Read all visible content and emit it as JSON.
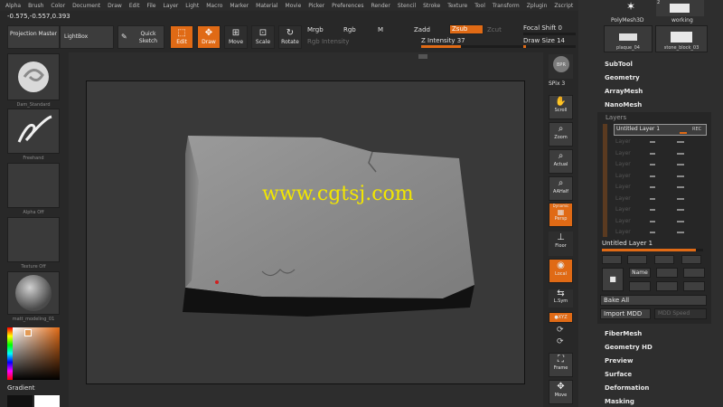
{
  "menu": [
    "Alpha",
    "Brush",
    "Color",
    "Document",
    "Draw",
    "Edit",
    "File",
    "Layer",
    "Light",
    "Macro",
    "Marker",
    "Material",
    "Movie",
    "Picker",
    "Preferences",
    "Render",
    "Stencil",
    "Stroke",
    "Texture",
    "Tool",
    "Transform",
    "Zplugin",
    "Zscript"
  ],
  "coords": "-0.575,-0.557,0.393",
  "toolbar": {
    "projection_master": "Projection Master",
    "lightbox": "LightBox",
    "quick_sketch": "Quick Sketch",
    "edit": "Edit",
    "draw": "Draw",
    "move": "Move",
    "scale": "Scale",
    "rotate": "Rotate",
    "mrgb": "Mrgb",
    "rgb": "Rgb",
    "m": "M",
    "rgb_intensity": "Rgb Intensity",
    "zadd": "Zadd",
    "zsub": "Zsub",
    "zcut": "Zcut",
    "z_intensity": "Z Intensity 37",
    "focal_shift": "Focal Shift 0",
    "draw_size": "Draw Size 14",
    "z_intensity_value": 0.37,
    "draw_size_fill": 0.05
  },
  "shelf": {
    "brush": "Dam_Standard",
    "stroke": "Freehand",
    "alpha": "Alpha Off",
    "texture": "Texture Off",
    "material": "matt_modeling_01",
    "gradient": "Gradient"
  },
  "watermark": "www.cgtsj.com",
  "nav": {
    "bpr": "BPR",
    "spix": "SPix 3",
    "scroll": "Scroll",
    "zoom": "Zoom",
    "actual": "Actual",
    "aahalf": "AAHalf",
    "dynamic": "Dynamic",
    "persp": "Persp",
    "floor": "Floor",
    "local": "Local",
    "lsym": "L.Sym",
    "xyz": "●XYZ",
    "frame": "Frame",
    "move": "Move"
  },
  "tray": {
    "polymesh3d": "PolyMesh3D",
    "working": "working",
    "working_count": "2",
    "plaque": "plaque_04",
    "stone": "stone_block_03",
    "subtool": "SubTool",
    "geometry": "Geometry",
    "arraymesh": "ArrayMesh",
    "nanomesh": "NanoMesh",
    "layers": "Layers",
    "active_layer": "Untitled Layer 1",
    "rec": "REC",
    "layer_rows": [
      "Layer",
      "Layer",
      "Layer",
      "Layer",
      "Layer",
      "Layer",
      "Layer",
      "Layer",
      "Layer"
    ],
    "layer_name": "Untitled Layer 1",
    "name_btn": "Name",
    "bake_all": "Bake All",
    "import_mdd": "Import MDD",
    "mdd_speed": "MDD Speed",
    "fibermesh": "FiberMesh",
    "geometry_hd": "Geometry HD",
    "preview": "Preview",
    "surface": "Surface",
    "deformation": "Deformation",
    "masking": "Masking"
  },
  "colors": {
    "accent": "#e06a15",
    "watermark": "#f2e600"
  }
}
